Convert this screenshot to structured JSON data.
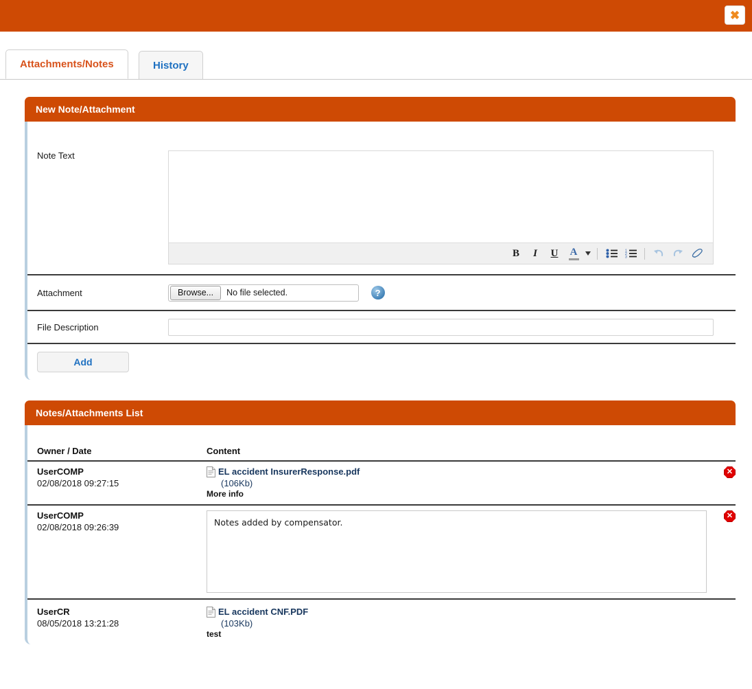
{
  "titlebar": {
    "close_label": "✖",
    "accent_color": "#ce4a04"
  },
  "tabs": [
    {
      "label": "Attachments/Notes",
      "active": true,
      "color": "#d8531c"
    },
    {
      "label": "History",
      "active": false,
      "color": "#1f71c1"
    }
  ],
  "new_note_panel": {
    "header": "New Note/Attachment",
    "note_text_label": "Note Text",
    "note_text_value": "",
    "toolbar": {
      "bold": "B",
      "italic": "I",
      "underline": "U",
      "font_color": "A",
      "caret": "▼",
      "bullet_list": "bullet-list",
      "numbered_list": "numbered-list",
      "undo": "↶",
      "redo": "↷",
      "eraser": "eraser"
    },
    "attachment_label": "Attachment",
    "browse_label": "Browse...",
    "file_status": "No file selected.",
    "help_glyph": "?",
    "file_description_label": "File Description",
    "file_description_value": "",
    "add_label": "Add"
  },
  "list_panel": {
    "header": "Notes/Attachments List",
    "columns": {
      "owner": "Owner / Date",
      "content": "Content"
    },
    "rows": [
      {
        "owner": "UserCOMP",
        "date": "02/08/2018 09:27:15",
        "type": "file",
        "file_name": "EL accident InsurerResponse.pdf",
        "file_size": "(106Kb)",
        "extra": "More info",
        "delete_label": "✕"
      },
      {
        "owner": "UserCOMP",
        "date": "02/08/2018 09:26:39",
        "type": "note",
        "note_text": "Notes added by compensator.",
        "delete_label": "✕"
      },
      {
        "owner": "UserCR",
        "date": "08/05/2018 13:21:28",
        "type": "file",
        "file_name": "EL accident CNF.PDF",
        "file_size": "(103Kb)",
        "extra": "test",
        "delete_label": "✕"
      }
    ]
  }
}
